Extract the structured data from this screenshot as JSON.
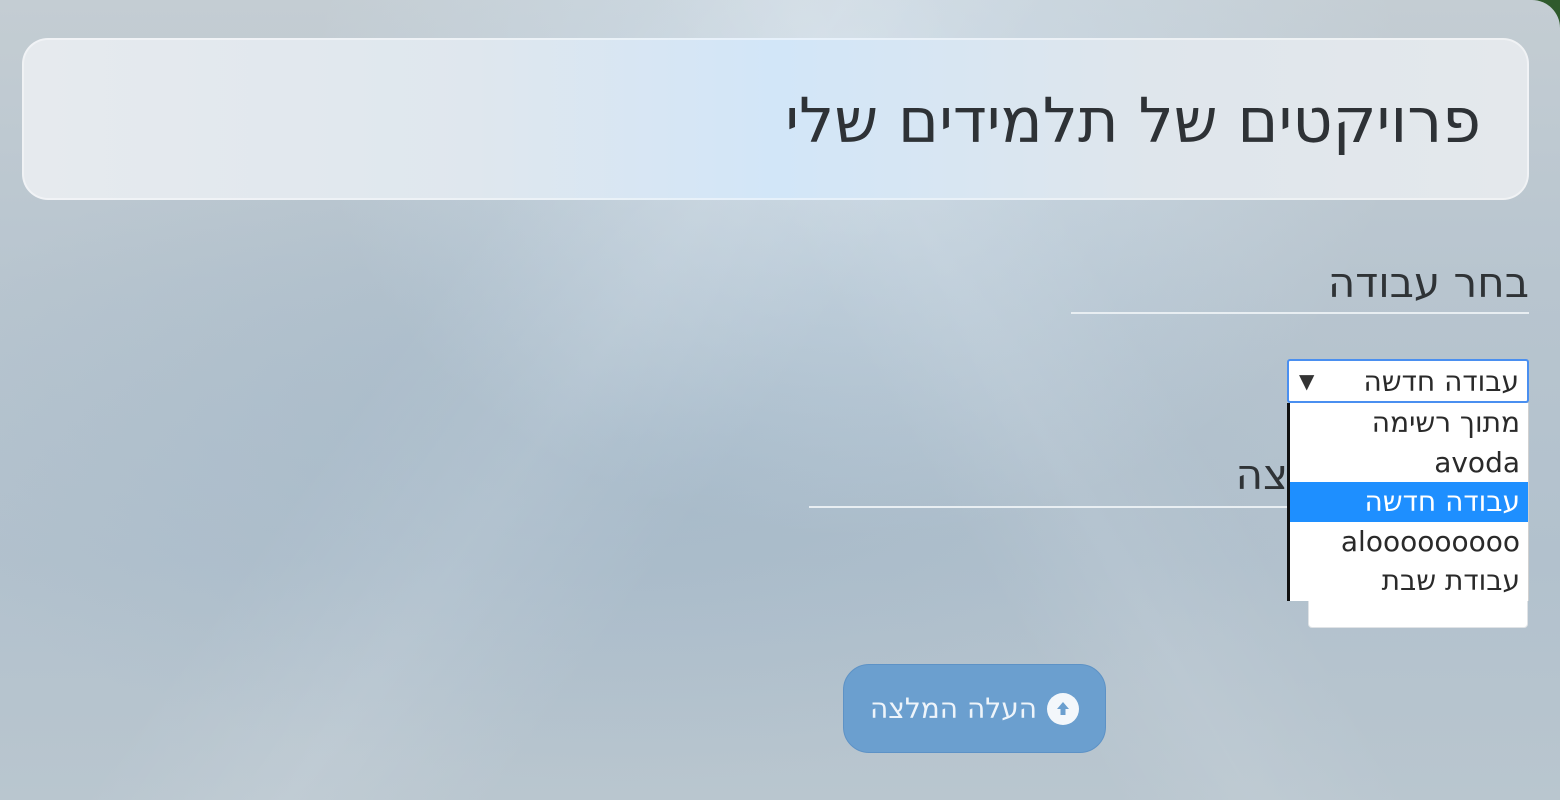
{
  "header": {
    "title": "פרויקטים של תלמידים שלי"
  },
  "work_select": {
    "label": "בחר עבודה",
    "selected_value": "עבודה חדשה",
    "options": [
      "מתוך רשימה",
      "avoda",
      "עבודה חדשה",
      "alooooooooo",
      "עבודת שבת"
    ],
    "highlighted_index": 2
  },
  "second_section": {
    "label_partial": "צה"
  },
  "upload_button": {
    "label": "העלה המלצה",
    "icon": "arrow-up-circle-icon"
  },
  "colors": {
    "accent": "#1e8fff",
    "button": "#6b9fcf"
  }
}
